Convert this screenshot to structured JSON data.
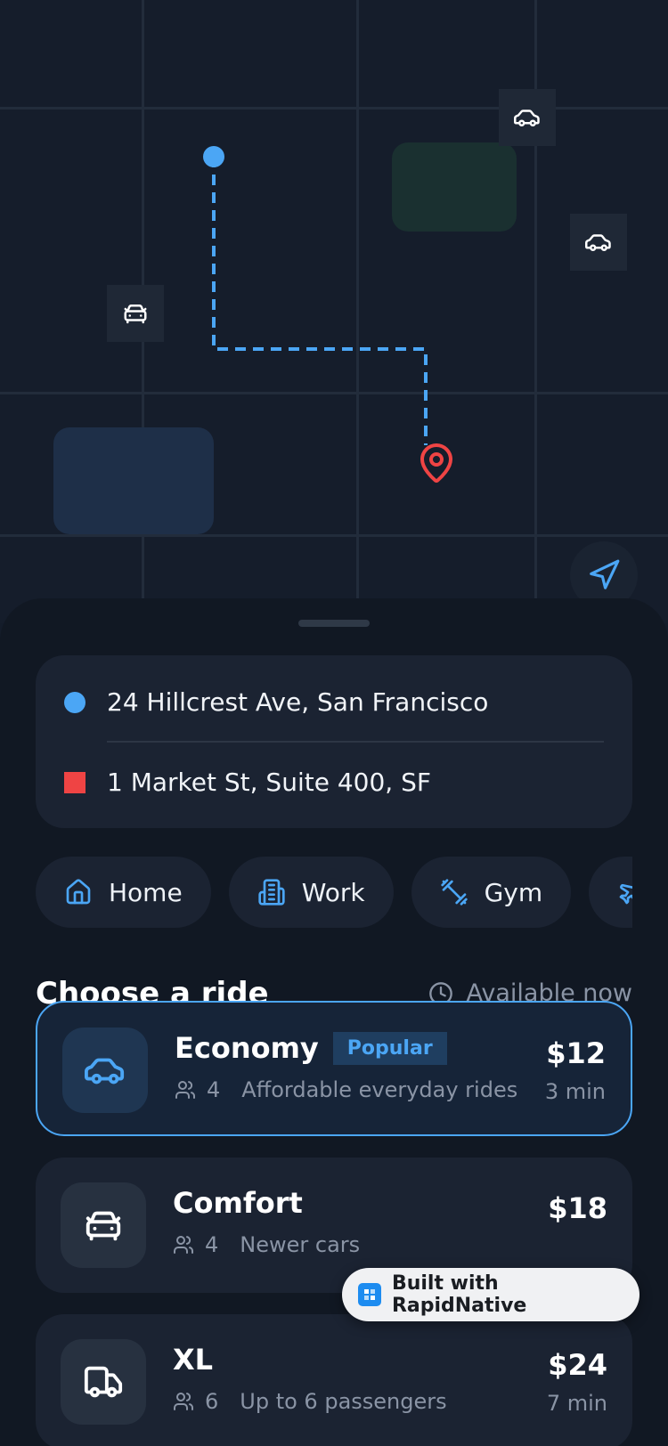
{
  "colors": {
    "accent": "#4ba6f5",
    "destination": "#ef4444",
    "background": "#111823",
    "card": "#1b2332"
  },
  "map": {
    "pickup_marker_icon": "circle-dot",
    "dropoff_marker_icon": "map-pin-icon",
    "car_icons": [
      "car-icon",
      "car-icon",
      "car-front-icon"
    ],
    "locate_icon": "navigation-arrow-icon"
  },
  "route": {
    "pickup": "24 Hillcrest Ave, San Francisco",
    "dropoff": "1 Market St, Suite 400, SF"
  },
  "quick_places": [
    {
      "label": "Home",
      "icon": "home-icon"
    },
    {
      "label": "Work",
      "icon": "building-icon"
    },
    {
      "label": "Gym",
      "icon": "dumbbell-icon"
    },
    {
      "label": "",
      "icon": "plane-icon"
    }
  ],
  "rides_section": {
    "title": "Choose a ride",
    "availability": "Available now",
    "availability_icon": "clock-icon"
  },
  "rides": [
    {
      "name": "Economy",
      "badge": "Popular",
      "seats": "4",
      "description": "Affordable everyday rides",
      "price": "$12",
      "eta": "3 min",
      "selected": true,
      "icon": "car-icon"
    },
    {
      "name": "Comfort",
      "badge": "",
      "seats": "4",
      "description": "Newer cars",
      "price": "$18",
      "eta": "",
      "selected": false,
      "icon": "car-front-icon"
    },
    {
      "name": "XL",
      "badge": "",
      "seats": "6",
      "description": "Up to 6 passengers",
      "price": "$24",
      "eta": "7 min",
      "selected": false,
      "icon": "truck-icon"
    }
  ],
  "watermark": {
    "label": "Built with RapidNative"
  }
}
